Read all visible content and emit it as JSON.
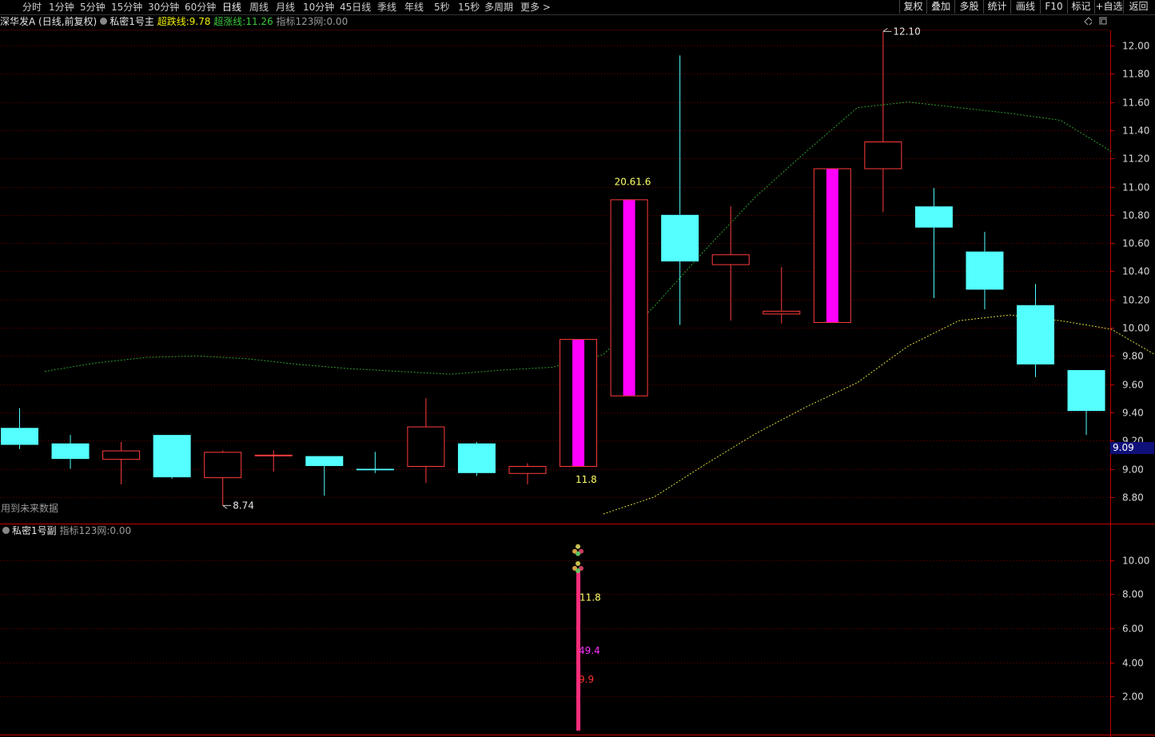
{
  "toolbar": {
    "periods": [
      "分时",
      "1分钟",
      "5分钟",
      "15分钟",
      "30分钟",
      "60分钟",
      "日线",
      "周线",
      "月线",
      "10分钟",
      "45日线",
      "季线",
      "年线",
      "5秒",
      "15秒",
      "多周期",
      "更多 >"
    ],
    "active_period": "日线",
    "right_buttons": [
      "复权",
      "叠加",
      "多股",
      "统计",
      "画线",
      "F10",
      "标记",
      "+自选",
      "返回"
    ]
  },
  "main_info": {
    "stock": "深华发A",
    "mode": "(日线,前复权)",
    "indicator": "私密1号主",
    "super_fall_label": "超跌线:",
    "super_fall_value": "9.78",
    "super_rise_label": "超涨线:",
    "super_rise_value": "11.26",
    "idx_label": "指标123网:",
    "idx_value": "0.00"
  },
  "sub_info": {
    "indicator": "私密1号副",
    "idx_label": "指标123网:",
    "idx_value": "0.00"
  },
  "future_note": "用到未来数据",
  "colors": {
    "up": "#ff3c3c",
    "down": "#54ffff",
    "magenta": "#ff00ff",
    "grid": "#6e0000",
    "axis": "#c00000",
    "super_rise_line": "#2e9e2e",
    "super_fall_line": "#d8d83a",
    "price_box": "#10107a"
  },
  "chart_data": [
    {
      "type": "candlestick",
      "title": "深华发A (日线,前复权)",
      "ylim": [
        8.66,
        12.28
      ],
      "y_ticks": [
        "12.00",
        "11.80",
        "11.60",
        "11.40",
        "11.20",
        "11.00",
        "10.80",
        "10.60",
        "10.40",
        "10.20",
        "10.00",
        "9.80",
        "9.60",
        "9.40",
        "9.20",
        "9.00",
        "8.80"
      ],
      "candles": [
        {
          "o": 9.29,
          "h": 9.43,
          "l": 9.14,
          "c": 9.17
        },
        {
          "o": 9.18,
          "h": 9.24,
          "l": 9.0,
          "c": 9.07
        },
        {
          "o": 9.07,
          "h": 9.19,
          "l": 8.89,
          "c": 9.13
        },
        {
          "o": 9.24,
          "h": 9.24,
          "l": 8.93,
          "c": 8.94
        },
        {
          "o": 8.94,
          "h": 9.13,
          "l": 8.74,
          "c": 9.12
        },
        {
          "o": 9.1,
          "h": 9.13,
          "l": 8.98,
          "c": 9.1
        },
        {
          "o": 9.09,
          "h": 9.09,
          "l": 8.81,
          "c": 9.02
        },
        {
          "o": 9.0,
          "h": 9.12,
          "l": 8.97,
          "c": 8.99
        },
        {
          "o": 9.02,
          "h": 9.5,
          "l": 8.9,
          "c": 9.3
        },
        {
          "o": 9.18,
          "h": 9.19,
          "l": 8.95,
          "c": 8.97
        },
        {
          "o": 8.97,
          "h": 9.04,
          "l": 8.89,
          "c": 9.02
        },
        {
          "o": 9.02,
          "h": 9.92,
          "l": 9.02,
          "c": 9.92,
          "magenta": true
        },
        {
          "o": 9.52,
          "h": 10.91,
          "l": 9.52,
          "c": 10.91,
          "magenta": true
        },
        {
          "o": 10.8,
          "h": 11.93,
          "l": 10.02,
          "c": 10.47
        },
        {
          "o": 10.45,
          "h": 10.86,
          "l": 10.05,
          "c": 10.52
        },
        {
          "o": 10.1,
          "h": 10.43,
          "l": 10.03,
          "c": 10.12
        },
        {
          "o": 10.04,
          "h": 11.13,
          "l": 10.04,
          "c": 11.13,
          "magenta": true
        },
        {
          "o": 11.13,
          "h": 12.1,
          "l": 10.82,
          "c": 11.32
        },
        {
          "o": 10.86,
          "h": 10.99,
          "l": 10.21,
          "c": 10.71
        },
        {
          "o": 10.54,
          "h": 10.68,
          "l": 10.13,
          "c": 10.27
        },
        {
          "o": 10.16,
          "h": 10.31,
          "l": 9.65,
          "c": 9.74
        },
        {
          "o": 9.7,
          "h": 9.7,
          "l": 9.24,
          "c": 9.41
        }
      ],
      "super_rise_line": [
        null,
        9.69,
        9.75,
        9.79,
        9.8,
        9.78,
        9.74,
        9.71,
        9.69,
        9.67,
        9.7,
        9.72,
        9.81,
        10.15,
        10.55,
        10.93,
        11.25,
        11.56,
        11.6,
        11.56,
        11.52,
        11.47,
        11.25
      ],
      "super_fall_line": [
        null,
        null,
        null,
        null,
        null,
        null,
        null,
        null,
        null,
        null,
        null,
        null,
        8.68,
        8.8,
        9.03,
        9.25,
        9.44,
        9.61,
        9.87,
        10.05,
        10.09,
        10.05,
        9.99,
        9.78
      ],
      "annotations": [
        "12.10",
        "8.74",
        "20.61.6",
        "11.8"
      ],
      "current_price": "9.09"
    },
    {
      "type": "bar",
      "ylim": [
        0,
        11.3
      ],
      "y_ticks": [
        "10.00",
        "8.00",
        "6.00",
        "4.00",
        "2.00"
      ],
      "bars": [
        {
          "index": 11,
          "value": 9.5
        }
      ],
      "dots_at": [
        10.6,
        9.6
      ],
      "labels": [
        "11.8",
        "49.4",
        "9.9"
      ]
    }
  ]
}
